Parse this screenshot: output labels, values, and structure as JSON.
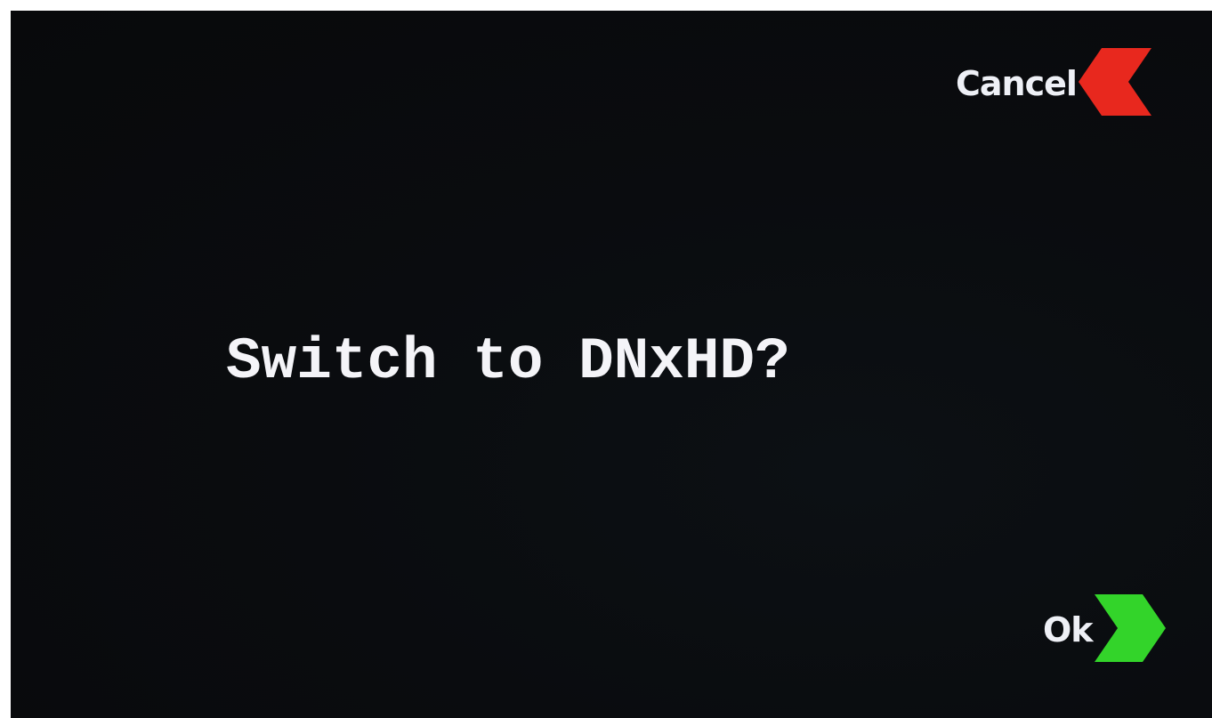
{
  "dialog": {
    "prompt": "Switch to DNxHD?",
    "cancel": {
      "label": "Cancel",
      "icon": "chevron-left-icon",
      "color": "#e8281e"
    },
    "ok": {
      "label": "Ok",
      "icon": "chevron-right-icon",
      "color": "#33d42a"
    }
  }
}
